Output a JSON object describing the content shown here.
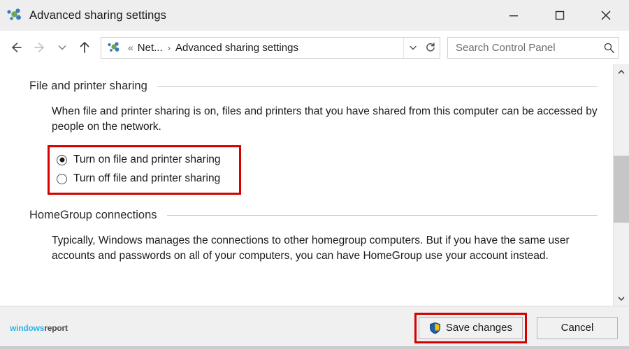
{
  "window": {
    "title": "Advanced sharing settings",
    "icon": "network-sharing-icon",
    "controls": {
      "minimize": "Minimize",
      "maximize": "Maximize",
      "close": "Close"
    }
  },
  "navbar": {
    "back": "Back",
    "forward": "Forward",
    "recent": "Recent locations",
    "up": "Up one level",
    "breadcrumb": {
      "overflow": "«",
      "items": [
        "Net...",
        "Advanced sharing settings"
      ],
      "separator": "›"
    },
    "dropdown": "Previous locations",
    "refresh": "Refresh"
  },
  "search": {
    "placeholder": "Search Control Panel",
    "value": "",
    "icon": "search-icon"
  },
  "main": {
    "sections": [
      {
        "heading": "File and printer sharing",
        "body": "When file and printer sharing is on, files and printers that you have shared from this computer can be accessed by people on the network.",
        "options": [
          {
            "label": "Turn on file and printer sharing",
            "selected": true
          },
          {
            "label": "Turn off file and printer sharing",
            "selected": false
          }
        ]
      },
      {
        "heading": "HomeGroup connections",
        "body": "Typically, Windows manages the connections to other homegroup computers. But if you have the same user accounts and passwords on all of your computers, you can have HomeGroup use your account instead."
      }
    ]
  },
  "scrollbar": {
    "up": "Scroll up",
    "down": "Scroll down"
  },
  "footer": {
    "watermark": {
      "part1": "windows",
      "part2": "report"
    },
    "save_label": "Save changes",
    "cancel_label": "Cancel",
    "save_icon": "uac-shield-icon"
  },
  "highlight_color": "#d60000"
}
